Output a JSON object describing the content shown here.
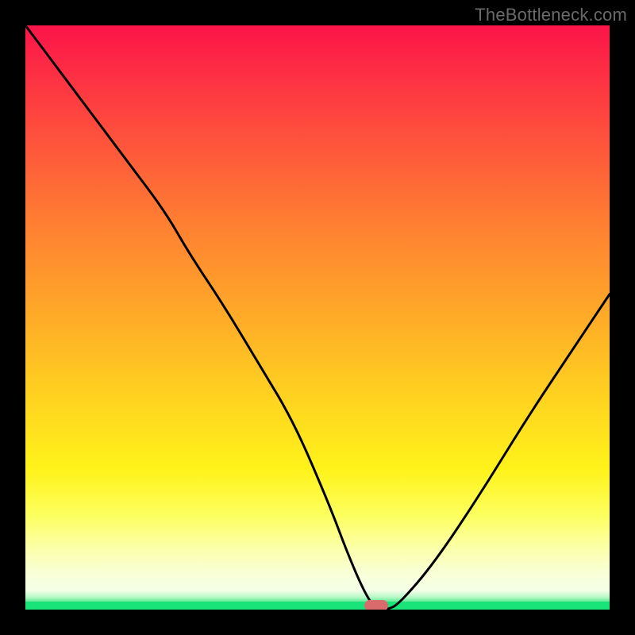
{
  "watermark": "TheBottleneck.com",
  "colors": {
    "frame_bg": "#000000",
    "watermark": "#6a6a6a",
    "curve": "#000000",
    "marker": "#d96b6d",
    "green_strip": "#18e47a"
  },
  "chart_data": {
    "type": "line",
    "title": "",
    "xlabel": "",
    "ylabel": "",
    "xlim": [
      0,
      100
    ],
    "ylim": [
      0,
      100
    ],
    "grid": false,
    "legend": false,
    "marker": {
      "x": 60,
      "y": 0
    },
    "series": [
      {
        "name": "bottleneck-curve",
        "x": [
          0,
          6,
          12,
          18,
          24,
          28,
          34,
          40,
          46,
          52,
          55,
          58,
          60,
          62,
          64,
          70,
          78,
          86,
          94,
          100
        ],
        "values": [
          100,
          92,
          84,
          76,
          68,
          61,
          52,
          42,
          32,
          18,
          10,
          3,
          0,
          0,
          1,
          8,
          20,
          33,
          45,
          54
        ]
      }
    ],
    "background_gradient_stops": [
      {
        "pos": 0,
        "hex": "#fc1449"
      },
      {
        "pos": 8,
        "hex": "#fd2e44"
      },
      {
        "pos": 22,
        "hex": "#fe5a3a"
      },
      {
        "pos": 34,
        "hex": "#ff7f32"
      },
      {
        "pos": 48,
        "hex": "#ffa629"
      },
      {
        "pos": 62,
        "hex": "#ffce21"
      },
      {
        "pos": 76,
        "hex": "#fff31a"
      },
      {
        "pos": 84,
        "hex": "#fdff60"
      },
      {
        "pos": 90,
        "hex": "#fbffb0"
      },
      {
        "pos": 94,
        "hex": "#f8ffd8"
      },
      {
        "pos": 97,
        "hex": "#f4ffe8"
      },
      {
        "pos": 100,
        "hex": "#eafff0"
      }
    ]
  }
}
